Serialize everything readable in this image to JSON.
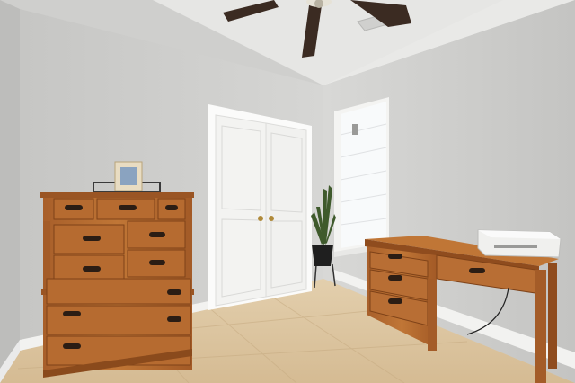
{
  "scene": {
    "kind": "photo",
    "colors": {
      "ceiling": "#e8e8e6",
      "wall_left": "#c9c9c7",
      "wall_back": "#d3d3d1",
      "wall_right": "#cbcbc9",
      "floor_tile": "#dcc6a2",
      "wood": "#b86e34",
      "wood_dark": "#8a4a1c",
      "door": "#f4f4f2",
      "window": "#f6f8fa",
      "printer": "#eeeeec"
    },
    "objects": [
      {
        "name": "ceiling-fan",
        "icon": "ceiling-fan-icon"
      },
      {
        "name": "closet-double-door",
        "icon": "door-icon"
      },
      {
        "name": "window-with-blinds",
        "icon": "window-icon"
      },
      {
        "name": "chest-of-drawers",
        "icon": "dresser-icon"
      },
      {
        "name": "writing-desk",
        "icon": "desk-icon"
      },
      {
        "name": "printer",
        "icon": "printer-icon"
      },
      {
        "name": "potted-plant",
        "icon": "plant-icon"
      },
      {
        "name": "picture-frame",
        "icon": "frame-icon"
      },
      {
        "name": "tiled-floor",
        "icon": "floor-icon"
      }
    ]
  }
}
